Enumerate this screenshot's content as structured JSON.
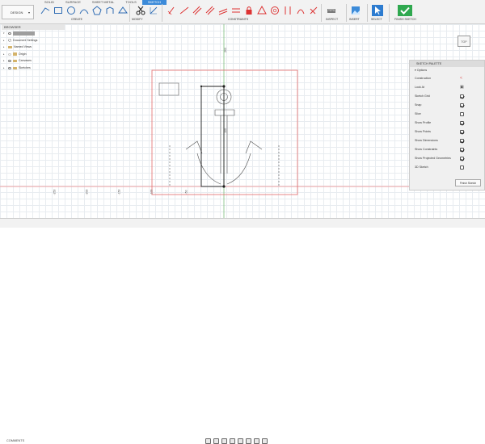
{
  "toolbar": {
    "workspace": "DESIGN",
    "tabs": [
      "SOLID",
      "SURFACE",
      "SHEET METAL",
      "TOOLS",
      "SKETCH"
    ],
    "active_tab": "SKETCH",
    "groups": {
      "create": "CREATE",
      "modify": "MODIFY",
      "constraints": "CONSTRAINTS",
      "inspect": "INSPECT",
      "insert": "INSERT",
      "select": "SELECT",
      "finish": "FINISH SKETCH"
    }
  },
  "browser": {
    "title": "BROWSER",
    "items": [
      {
        "label": "(Unsaved)",
        "kind": "document"
      },
      {
        "label": "Document Settings",
        "kind": "settings"
      },
      {
        "label": "Named Views",
        "kind": "folder"
      },
      {
        "label": "Origin",
        "kind": "folder"
      },
      {
        "label": "Canvases",
        "kind": "folder"
      },
      {
        "label": "Sketches",
        "kind": "folder"
      }
    ]
  },
  "viewcube": {
    "label": "TOP"
  },
  "sketch_palette": {
    "title": "SKETCH PALETTE",
    "section": "Options",
    "rows": [
      {
        "label": "Construction",
        "type": "icon",
        "icon": "construction-icon"
      },
      {
        "label": "Look At",
        "type": "icon",
        "icon": "look-at-icon"
      },
      {
        "label": "Sketch Grid",
        "type": "check",
        "checked": true
      },
      {
        "label": "Snap",
        "type": "check",
        "checked": true
      },
      {
        "label": "Slice",
        "type": "check",
        "checked": false
      },
      {
        "label": "Show Profile",
        "type": "check",
        "checked": true
      },
      {
        "label": "Show Points",
        "type": "check",
        "checked": true
      },
      {
        "label": "Show Dimensions",
        "type": "check",
        "checked": true
      },
      {
        "label": "Show Constraints",
        "type": "check",
        "checked": true
      },
      {
        "label": "Show Projected Geometries",
        "type": "check",
        "checked": true
      },
      {
        "label": "3D Sketch",
        "type": "check",
        "checked": false
      }
    ],
    "finish_button": "Finish Sketch"
  },
  "canvas": {
    "axis_labels": [
      "-250",
      "-200",
      "-150",
      "-100",
      "-50",
      "100",
      "200"
    ]
  },
  "bottom": {
    "comments": "COMMENTS"
  }
}
